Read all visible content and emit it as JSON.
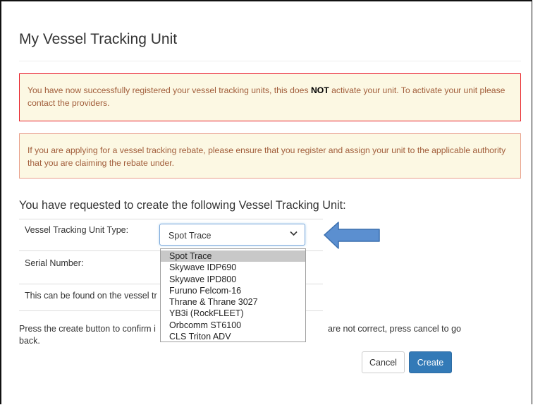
{
  "page": {
    "title": "My Vessel Tracking Unit"
  },
  "alerts": {
    "success_pre": "You have now successfully registered your vessel tracking units, this does ",
    "success_bold": "NOT",
    "success_post": " activate your unit. To activate your unit please contact the providers.",
    "rebate": "If you are applying for a vessel tracking rebate, please ensure that you register and assign your unit to the applicable authority that you are claiming the rebate under."
  },
  "form": {
    "subtitle": "You have requested to create the following Vessel Tracking Unit:",
    "type_label": "Vessel Tracking Unit Type:",
    "type_value": "Spot Trace",
    "type_options": [
      "Spot Trace",
      "Skywave IDP690",
      "Skywave IPD800",
      "Furuno Felcom-16",
      "Thrane & Thrane 3027",
      "YB3i (RockFLEET)",
      "Orbcomm ST6100",
      "CLS Triton ADV"
    ],
    "serial_label": "Serial Number:",
    "hint_text": "This can be found on the vessel tr",
    "confirm_part1": "Press the create button to confirm i",
    "confirm_part2": "are not correct, press cancel to go",
    "confirm_part3": "back."
  },
  "buttons": {
    "cancel": "Cancel",
    "create": "Create"
  },
  "colors": {
    "primary": "#337ab7",
    "alert_bg": "#fcf8e3",
    "alert_text": "#a15d3a",
    "alert_border_red": "#e8202b",
    "annotation_arrow": "#5b8fd0"
  }
}
